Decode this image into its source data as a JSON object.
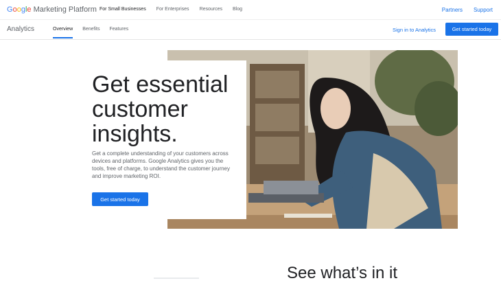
{
  "topbar": {
    "brand_google": "Google",
    "brand_product": "Marketing Platform",
    "nav": [
      "For Small Businesses",
      "For Enterprises",
      "Resources",
      "Blog"
    ],
    "right": [
      "Partners",
      "Support"
    ]
  },
  "subbar": {
    "product": "Analytics",
    "nav": [
      "Overview",
      "Benefits",
      "Features"
    ],
    "signin": "Sign in to Analytics",
    "cta": "Get started today"
  },
  "hero": {
    "headline": "Get essential customer insights.",
    "description": "Get a complete understanding of your customers across devices and platforms. Google Analytics gives you the tools, free of charge, to understand the customer journey and improve marketing ROI.",
    "cta": "Get started today"
  },
  "section": {
    "title": "See what’s in it"
  },
  "colors": {
    "accent": "#1a73e8",
    "text": "#202124",
    "muted": "#5f6368"
  }
}
